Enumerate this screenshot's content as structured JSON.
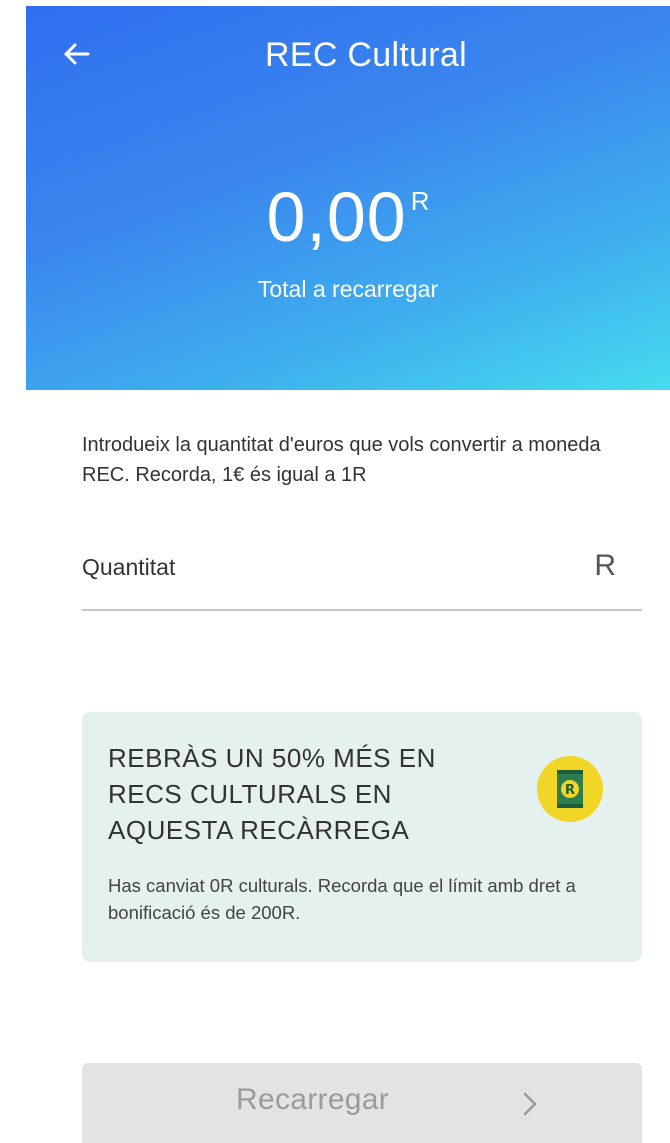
{
  "header": {
    "title": "REC Cultural",
    "back_icon": "arrow-left-icon",
    "amount": "0,00",
    "amount_unit": "R",
    "amount_caption": "Total a recarregar",
    "gradient_colors": [
      "#2f6ff0",
      "#45dcef"
    ]
  },
  "intro_text": "Introdueix la quantitat d'euros que vols convertir a moneda REC. Recorda, 1€ és igual a 1R",
  "amount_field": {
    "placeholder": "Quantitat",
    "value": "",
    "unit_symbol": "R"
  },
  "promo": {
    "title": "REBRÀS UN 50% MÉS EN RECS CULTURALS EN AQUESTA RECÀRREGA",
    "icon": "rec-ticket-icon",
    "text": "Has canviat 0R culturals. Recorda que el límit amb dret a bonificació és de 200R.",
    "background_color": "#e5f1ee",
    "icon_color": "#f1d627"
  },
  "recharge_button": {
    "label": "Recarregar",
    "icon": "chevron-right-icon",
    "disabled": true
  }
}
